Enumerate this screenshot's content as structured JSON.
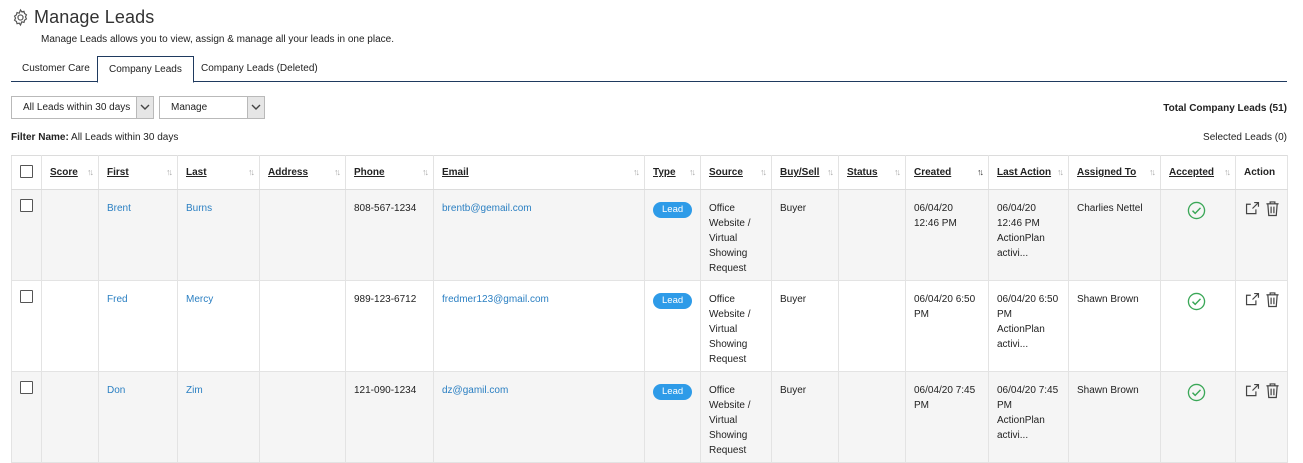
{
  "page": {
    "title": "Manage Leads",
    "subtitle": "Manage Leads allows you to view, assign & manage all your leads in one place."
  },
  "tabs": [
    {
      "label": "Customer Care",
      "active": false
    },
    {
      "label": "Company Leads",
      "active": true
    },
    {
      "label": "Company Leads (Deleted)",
      "active": false
    }
  ],
  "filters": {
    "range_select": "All Leads within 30 days",
    "manage_select": "Manage",
    "total_label": "Total Company Leads (51)",
    "filter_name_label": "Filter Name:",
    "filter_name_value": "All Leads within 30 days",
    "selected_leads": "Selected Leads (0)"
  },
  "table": {
    "columns": [
      "Score",
      "First",
      "Last",
      "Address",
      "Phone",
      "Email",
      "Type",
      "Source",
      "Buy/Sell",
      "Status",
      "Created",
      "Last Action",
      "Assigned To",
      "Accepted",
      "Action"
    ],
    "rows": [
      {
        "score": "",
        "first": "Brent",
        "last": "Burns",
        "address": "",
        "phone": "808-567-1234",
        "email": "brentb@gemail.com",
        "type": "Lead",
        "source": "Office Website / Virtual Showing Request",
        "buysell": "Buyer",
        "status": "",
        "created": "06/04/20 12:46 PM",
        "last_action": "06/04/20 12:46 PM ActionPlan activi...",
        "assigned_to": "Charlies Nettel"
      },
      {
        "score": "",
        "first": "Fred",
        "last": "Mercy",
        "address": "",
        "phone": "989-123-6712",
        "email": "fredmer123@gmail.com",
        "type": "Lead",
        "source": "Office Website / Virtual Showing Request",
        "buysell": "Buyer",
        "status": "",
        "created": "06/04/20 6:50 PM",
        "last_action": "06/04/20 6:50 PM ActionPlan activi...",
        "assigned_to": "Shawn Brown"
      },
      {
        "score": "",
        "first": "Don",
        "last": "Zim",
        "address": "",
        "phone": "121-090-1234",
        "email": "dz@gamil.com",
        "type": "Lead",
        "source": "Office Website / Virtual Showing Request",
        "buysell": "Buyer",
        "status": "",
        "created": "06/04/20 7:45 PM",
        "last_action": "06/04/20 7:45 PM ActionPlan activi...",
        "assigned_to": "Shawn Brown"
      }
    ]
  },
  "colors": {
    "accent": "#2e9be8",
    "link": "#2a7fc2",
    "success": "#3aa757",
    "tab_border": "#1f3a5f"
  }
}
